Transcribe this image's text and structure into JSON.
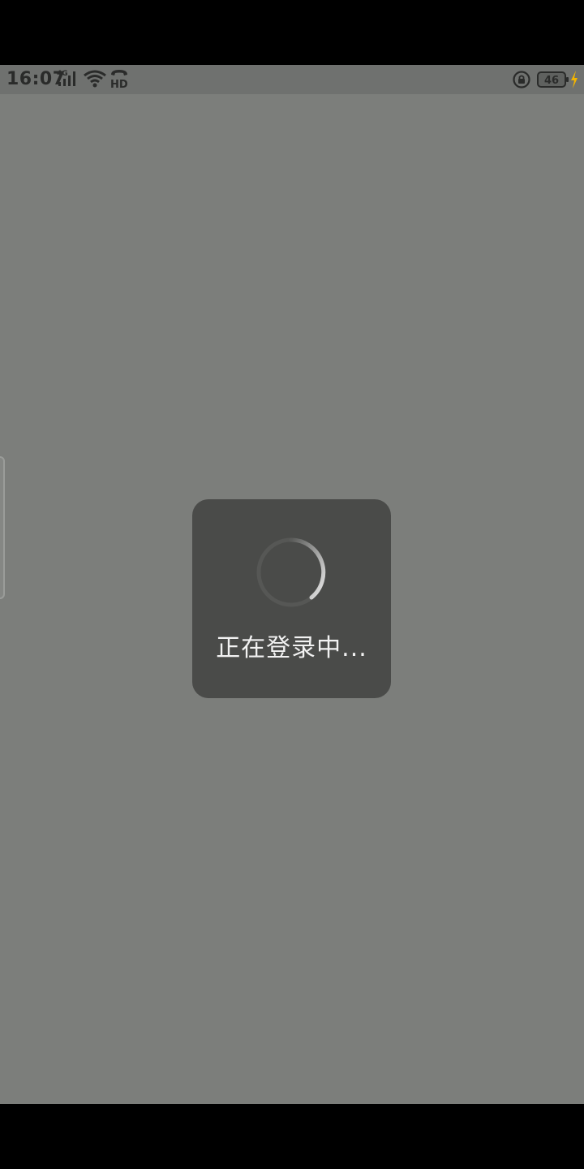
{
  "status_bar": {
    "time": "16:07",
    "network_type": "4G",
    "hd_label": "HD",
    "battery_level": "46",
    "icons": [
      "signal-icon",
      "wifi-icon",
      "hd-call-icon",
      "rotation-lock-icon",
      "battery-icon",
      "charging-bolt-icon"
    ],
    "charging_color": "#f2b400"
  },
  "dialog": {
    "message": "正在登录中...",
    "spinner_icon": "loading-spinner-icon"
  },
  "colors": {
    "overlay": "#7c7e7b",
    "dialog_bg": "#4a4b49",
    "status_bar_bg": "#6f716f"
  }
}
